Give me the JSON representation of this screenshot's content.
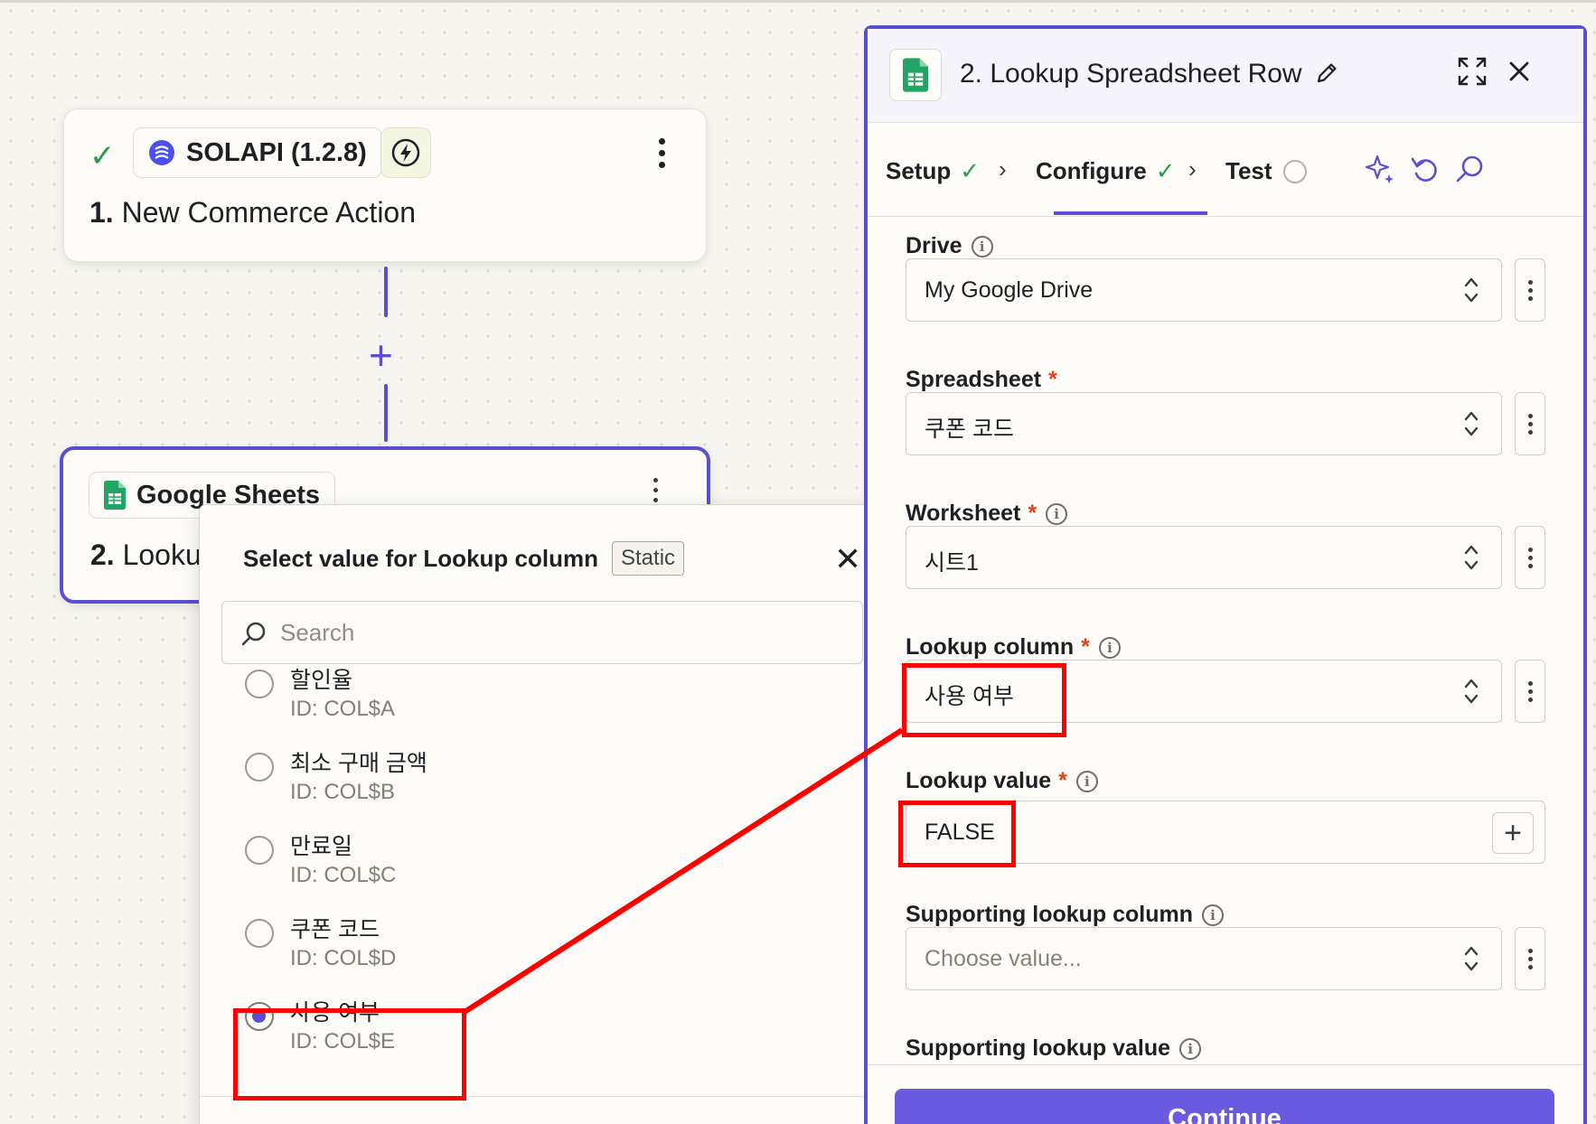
{
  "canvas": {
    "step1": {
      "app_name": "SOLAPI (1.2.8)",
      "title_number": "1.",
      "title_text": "New Commerce Action"
    },
    "step2": {
      "app_name": "Google Sheets",
      "title_number": "2.",
      "title_text": "Lookup Spreadsheet Row"
    }
  },
  "popover": {
    "title": "Select value for Lookup column",
    "badge": "Static",
    "search_placeholder": "Search",
    "options": [
      {
        "label": "할인율",
        "id": "ID: COL$A",
        "selected": false
      },
      {
        "label": "최소 구매 금액",
        "id": "ID: COL$B",
        "selected": false
      },
      {
        "label": "만료일",
        "id": "ID: COL$C",
        "selected": false
      },
      {
        "label": "쿠폰 코드",
        "id": "ID: COL$D",
        "selected": false
      },
      {
        "label": "사용 여부",
        "id": "ID: COL$E",
        "selected": true
      }
    ]
  },
  "panel": {
    "title": "2. Lookup Spreadsheet Row",
    "tabs": [
      {
        "label": "Setup",
        "state": "done"
      },
      {
        "label": "Configure",
        "state": "active"
      },
      {
        "label": "Test",
        "state": "pending"
      }
    ],
    "fields": {
      "drive": {
        "label": "Drive",
        "value": "My Google Drive"
      },
      "spreadsheet": {
        "label": "Spreadsheet",
        "value": "쿠폰 코드"
      },
      "worksheet": {
        "label": "Worksheet",
        "value": "시트1"
      },
      "lookup_column": {
        "label": "Lookup column",
        "value": "사용 여부"
      },
      "lookup_value": {
        "label": "Lookup value",
        "value": "FALSE"
      },
      "supporting_column": {
        "label": "Supporting lookup column",
        "placeholder": "Choose value..."
      },
      "supporting_value": {
        "label": "Supporting lookup value"
      }
    },
    "continue_label": "Continue"
  },
  "colors": {
    "accent": "#5a4fd3",
    "success": "#2e9b4d",
    "required": "#e2401c",
    "highlight": "#ff0000",
    "sheets_green": "#21a464"
  },
  "icons": [
    "check-icon",
    "solapi-icon",
    "bolt-icon",
    "google-sheets-icon",
    "pencil-icon",
    "expand-icon",
    "close-icon",
    "search-icon",
    "info-icon",
    "sparkle-icon",
    "undo-icon",
    "chevron-up-down-icon",
    "plus-icon"
  ]
}
